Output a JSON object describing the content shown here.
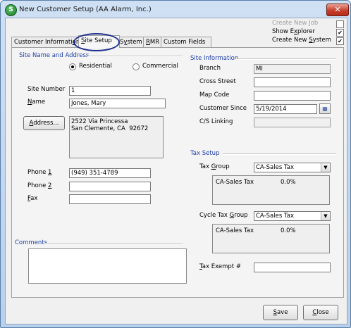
{
  "window": {
    "title": "New Customer Setup (AA Alarm, Inc.)",
    "close_glyph": "✕",
    "app_icon_letter": "S"
  },
  "top_options": [
    {
      "label": "Create New Job",
      "checked": false,
      "disabled": true
    },
    {
      "label": "Show Explorer",
      "checked": true,
      "disabled": false
    },
    {
      "label": "Create New System",
      "checked": true,
      "disabled": false
    }
  ],
  "tabs": [
    {
      "label": "Customer Information"
    },
    {
      "label": "Site Setup",
      "active": true
    },
    {
      "label": "System"
    },
    {
      "label": "RMR"
    },
    {
      "label": "Custom Fields"
    }
  ],
  "site_name_address": {
    "section_title": "Site Name and Address",
    "residential_label": "Residential",
    "commercial_label": "Commercial",
    "selected": "Residential",
    "site_number_label": "Site Number",
    "site_number_value": "1",
    "name_label": "Name",
    "name_value": "Jones, Mary",
    "address_button": "Address...",
    "address_lines": "2522 Via Princessa\nSan Clemente, CA  92672",
    "phone1_label": "Phone 1",
    "phone1_value": "(949) 351-4789",
    "phone2_label": "Phone 2",
    "phone2_value": "",
    "fax_label": "Fax",
    "fax_value": ""
  },
  "comments": {
    "section_title": "Comments",
    "value": ""
  },
  "site_information": {
    "section_title": "Site Information",
    "branch_label": "Branch",
    "branch_value": "MI",
    "cross_street_label": "Cross Street",
    "cross_street_value": "",
    "map_code_label": "Map Code",
    "map_code_value": "",
    "customer_since_label": "Customer Since",
    "customer_since_value": "5/19/2014",
    "cs_linking_label": "C/S Linking",
    "cs_linking_value": ""
  },
  "tax_setup": {
    "section_title": "Tax Setup",
    "tax_group_label": "Tax Group",
    "tax_group_value": "CA-Sales Tax",
    "tax_group_rows": [
      {
        "name": "CA-Sales Tax",
        "rate": "0.0%"
      }
    ],
    "cycle_tax_group_label": "Cycle Tax Group",
    "cycle_tax_group_value": "CA-Sales Tax",
    "cycle_tax_rows": [
      {
        "name": "CA-Sales Tax",
        "rate": "0.0%"
      }
    ],
    "tax_exempt_label": "Tax Exempt #",
    "tax_exempt_value": ""
  },
  "footer": {
    "save_label": "Save",
    "close_label": "Close"
  }
}
